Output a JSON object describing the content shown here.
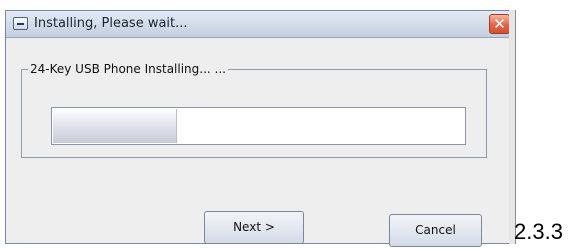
{
  "dialog": {
    "title": "Installing, Please wait...",
    "close_glyph": "✕",
    "group_label": "24-Key USB Phone Installing... ...",
    "progress_fraction": 0.3
  },
  "buttons": {
    "next_label": "Next >",
    "cancel_label": "Cancel"
  },
  "version_label": "2.3.3",
  "icons": {
    "system_menu": "window-menu-icon",
    "close": "close-icon"
  },
  "colors": {
    "titlebar": "#d3dcea",
    "close_button": "#e0674b",
    "window_body": "#eeeeee"
  }
}
